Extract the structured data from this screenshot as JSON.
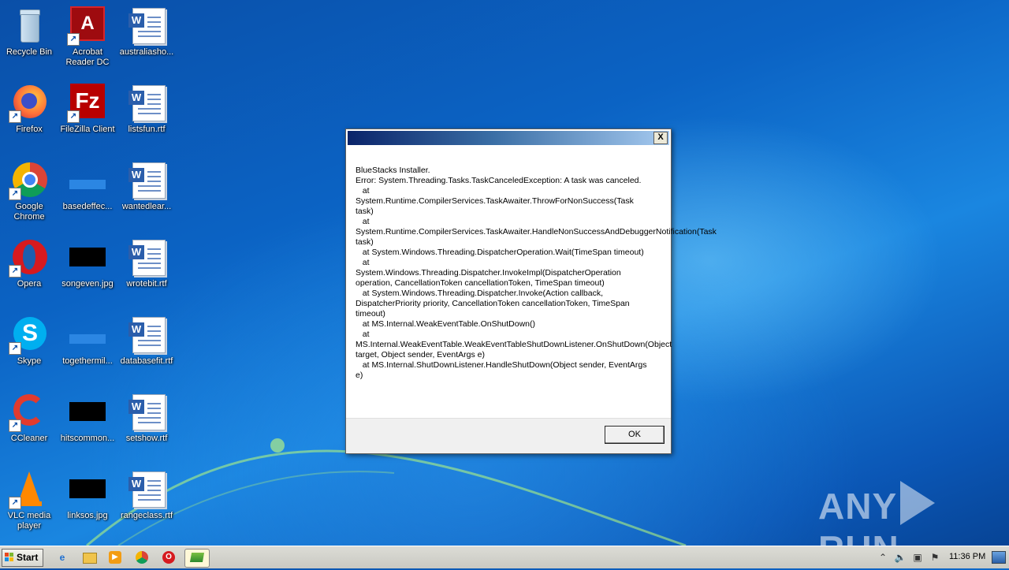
{
  "desktop": {
    "icons": [
      {
        "label": "Recycle Bin"
      },
      {
        "label": "Acrobat Reader DC"
      },
      {
        "label": "australiasho..."
      },
      {
        "label": "Firefox"
      },
      {
        "label": "FileZilla Client"
      },
      {
        "label": "listsfun.rtf"
      },
      {
        "label": "Google Chrome"
      },
      {
        "label": "basedeffec..."
      },
      {
        "label": "wantedlear..."
      },
      {
        "label": "Opera"
      },
      {
        "label": "songeven.jpg"
      },
      {
        "label": "wrotebit.rtf"
      },
      {
        "label": "Skype"
      },
      {
        "label": "togethermil..."
      },
      {
        "label": "databasefit.rtf"
      },
      {
        "label": "CCleaner"
      },
      {
        "label": "hitscommon..."
      },
      {
        "label": "setshow.rtf"
      },
      {
        "label": "VLC media player"
      },
      {
        "label": "linksos.jpg"
      },
      {
        "label": "rangeclass.rtf"
      }
    ]
  },
  "dialog": {
    "title": "",
    "close_label": "X",
    "message": "BlueStacks Installer.\nError: System.Threading.Tasks.TaskCanceledException: A task was canceled.\n   at\nSystem.Runtime.CompilerServices.TaskAwaiter.ThrowForNonSuccess(Task task)\n   at\nSystem.Runtime.CompilerServices.TaskAwaiter.HandleNonSuccessAndDebuggerNotification(Task task)\n   at System.Windows.Threading.DispatcherOperation.Wait(TimeSpan timeout)\n   at\nSystem.Windows.Threading.Dispatcher.InvokeImpl(DispatcherOperation operation, CancellationToken cancellationToken, TimeSpan timeout)\n   at System.Windows.Threading.Dispatcher.Invoke(Action callback, DispatcherPriority priority, CancellationToken cancellationToken, TimeSpan timeout)\n   at MS.Internal.WeakEventTable.OnShutDown()\n   at\nMS.Internal.WeakEventTable.WeakEventTableShutDownListener.OnShutDown(Object target, Object sender, EventArgs e)\n   at MS.Internal.ShutDownListener.HandleShutDown(Object sender, EventArgs e)",
    "ok_label": "OK"
  },
  "watermark": {
    "left": "ANY",
    "right": "RUN"
  },
  "taskbar": {
    "start_label": "Start",
    "clock": "11:36 PM",
    "pinned": [
      "ie-icon",
      "explorer-icon",
      "media-player-icon",
      "chrome-icon",
      "opera-icon",
      "bluestacks-icon"
    ]
  },
  "colors": {
    "titlebar_start": "#0a246a",
    "titlebar_end": "#a6caf0",
    "desktop": "#0b63c4"
  }
}
